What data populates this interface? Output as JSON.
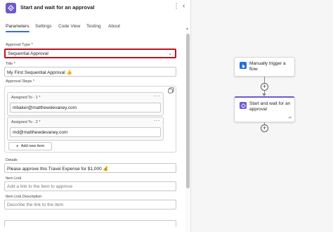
{
  "header": {
    "title": "Start and wait for an approval",
    "more_icon": "more-vertical-icon",
    "collapse_icon": "chevron-left-icon"
  },
  "tabs": [
    {
      "label": "Parameters",
      "active": true
    },
    {
      "label": "Settings",
      "active": false
    },
    {
      "label": "Code View",
      "active": false
    },
    {
      "label": "Testing",
      "active": false
    },
    {
      "label": "About",
      "active": false
    }
  ],
  "form": {
    "approval_type": {
      "label": "Approval Type *",
      "value": "Sequential Approval"
    },
    "title": {
      "label": "Title *",
      "value": "My First Sequential Approval 👍"
    },
    "approval_steps": {
      "label": "Approval Steps *",
      "steps": [
        {
          "label": "Assigned To - 1 *",
          "value": "mbaker@matthewdevaney.com"
        },
        {
          "label": "Assigned To - 2 *",
          "value": "md@matthewdevaney.com"
        }
      ],
      "add_label": "Add new item"
    },
    "details": {
      "label": "Details",
      "value": "Please approve this Travel Expense for $1,000 💰"
    },
    "item_link": {
      "label": "Item Link",
      "placeholder": "Add a link to the item to approve"
    },
    "item_link_description": {
      "label": "Item Link Description",
      "placeholder": "Describe the link to the item"
    }
  },
  "canvas": {
    "trigger_card": {
      "title": "Manually trigger a flow",
      "color": "#1f6fd6"
    },
    "approval_card": {
      "title": "Start and wait for an approval",
      "color": "#6a5acd"
    }
  },
  "colors": {
    "accent": "#3b6bd6",
    "highlight_border": "#c50f1f",
    "approval_purple": "#6a5acd",
    "trigger_blue": "#1f6fd6"
  }
}
